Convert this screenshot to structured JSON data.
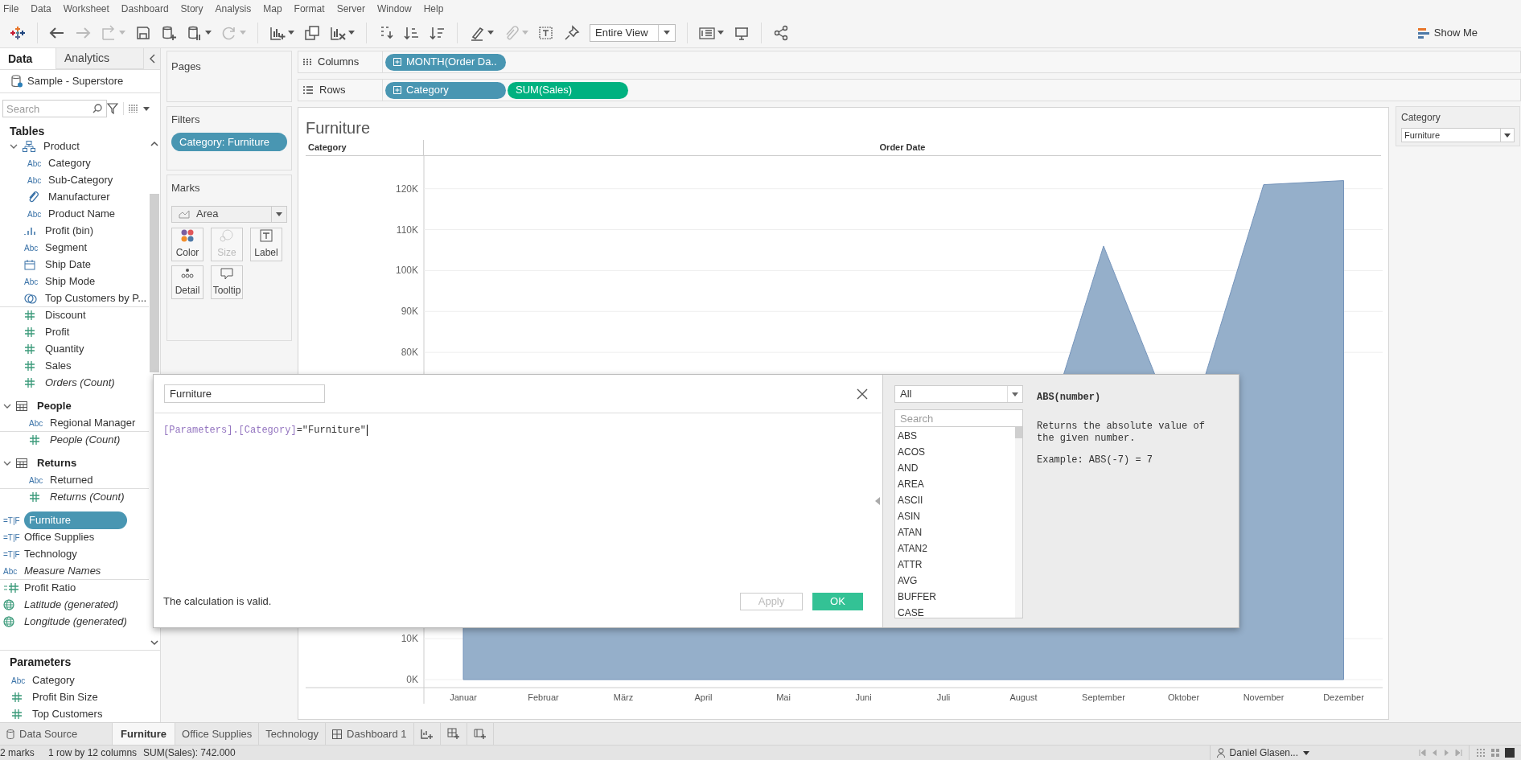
{
  "menu": [
    "File",
    "Data",
    "Worksheet",
    "Dashboard",
    "Story",
    "Analysis",
    "Map",
    "Format",
    "Server",
    "Window",
    "Help"
  ],
  "toolbar": [
    {
      "kind": "logo"
    },
    {
      "kind": "undo",
      "disabled": false,
      "dropdown": false
    },
    {
      "kind": "redo",
      "disabled": true,
      "dropdown": false
    },
    {
      "kind": "replay",
      "disabled": true,
      "dropdown": true
    },
    {
      "kind": "save",
      "disabled": false,
      "dropdown": false
    },
    {
      "kind": "new-datasource",
      "disabled": false,
      "dropdown": false
    },
    {
      "kind": "pause",
      "disabled": false,
      "dropdown": true
    },
    {
      "kind": "refresh",
      "disabled": true,
      "dropdown": true
    },
    {
      "kind": "new-sheet",
      "disabled": false,
      "dropdown": true
    },
    {
      "kind": "duplicate",
      "disabled": false,
      "dropdown": false
    },
    {
      "kind": "clear",
      "disabled": false,
      "dropdown": true
    },
    {
      "kind": "swap",
      "disabled": false,
      "dropdown": false
    },
    {
      "kind": "sort-asc",
      "disabled": false,
      "dropdown": false
    },
    {
      "kind": "sort-desc",
      "disabled": false,
      "dropdown": false
    },
    {
      "kind": "highlight",
      "disabled": false,
      "dropdown": true
    },
    {
      "kind": "clip",
      "disabled": true,
      "dropdown": true
    },
    {
      "kind": "text",
      "disabled": false,
      "dropdown": false
    },
    {
      "kind": "pin",
      "disabled": false,
      "dropdown": false
    },
    {
      "kind": "fit",
      "label": "Entire View",
      "disabled": false,
      "dropdown": true
    },
    {
      "kind": "cards",
      "disabled": false,
      "dropdown": true
    },
    {
      "kind": "present",
      "disabled": false,
      "dropdown": false
    },
    {
      "kind": "share",
      "disabled": false,
      "dropdown": false
    }
  ],
  "show_me": "Show Me",
  "side_tabs": [
    {
      "label": "Data",
      "selected": true
    },
    {
      "label": "Analytics",
      "selected": false
    }
  ],
  "datasource": "Sample - Superstore",
  "search": {
    "placeholder": "Search"
  },
  "tables_heading": "Tables",
  "fields": [
    {
      "kind": "hierarchy",
      "label": "Product",
      "expanded": true,
      "selected": false,
      "children": [
        {
          "kind": "abc",
          "type_label": "Abc",
          "label": "Category",
          "selected": false
        },
        {
          "kind": "abc",
          "type_label": "Abc",
          "label": "Sub-Category",
          "selected": false
        },
        {
          "kind": "group",
          "label": "Manufacturer",
          "selected": false
        },
        {
          "kind": "abc",
          "type_label": "Abc",
          "label": "Product Name",
          "selected": false
        }
      ]
    },
    {
      "kind": "bin",
      "label": "Profit (bin)",
      "selected": false
    },
    {
      "kind": "abc",
      "type_label": "Abc",
      "label": "Segment",
      "selected": false
    },
    {
      "kind": "date",
      "label": "Ship Date",
      "selected": false
    },
    {
      "kind": "abc",
      "type_label": "Abc",
      "label": "Ship Mode",
      "selected": false
    },
    {
      "kind": "set",
      "label": "Top Customers by P...",
      "selected": false
    },
    {
      "kind": "measure",
      "label": "Discount",
      "separator": true,
      "selected": false
    },
    {
      "kind": "measure",
      "label": "Profit",
      "selected": false
    },
    {
      "kind": "measure",
      "label": "Quantity",
      "selected": false
    },
    {
      "kind": "measure",
      "label": "Sales",
      "selected": false
    },
    {
      "kind": "measure",
      "label": "Orders (Count)",
      "italic": true,
      "selected": false
    },
    {
      "kind": "table",
      "label": "People",
      "expanded": true,
      "selected": false,
      "children": [
        {
          "kind": "abc",
          "type_label": "Abc",
          "label": "Regional Manager",
          "selected": false
        },
        {
          "kind": "measure",
          "label": "People (Count)",
          "italic": true,
          "separator": true,
          "selected": false
        }
      ]
    },
    {
      "kind": "table",
      "label": "Returns",
      "expanded": true,
      "selected": false,
      "children": [
        {
          "kind": "abc",
          "type_label": "Abc",
          "label": "Returned",
          "selected": false
        },
        {
          "kind": "measure",
          "label": "Returns (Count)",
          "italic": true,
          "separator": true,
          "selected": false
        }
      ]
    },
    {
      "kind": "boolean",
      "type_label": "=T|F",
      "label": "Furniture",
      "selected": true
    },
    {
      "kind": "boolean",
      "type_label": "=T|F",
      "label": "Office Supplies",
      "selected": false
    },
    {
      "kind": "boolean",
      "type_label": "=T|F",
      "label": "Technology",
      "selected": false
    },
    {
      "kind": "abc",
      "type_label": "Abc",
      "label": "Measure Names",
      "italic": true,
      "selected": false
    },
    {
      "kind": "calc",
      "label": "Profit Ratio",
      "separator": true,
      "selected": false
    },
    {
      "kind": "geo",
      "label": "Latitude (generated)",
      "italic": true,
      "selected": false
    },
    {
      "kind": "geo",
      "label": "Longitude (generated)",
      "italic": true,
      "selected": false
    }
  ],
  "parameters": {
    "heading": "Parameters",
    "items": [
      {
        "kind": "abc",
        "type_label": "Abc",
        "label": "Category",
        "selected": false
      },
      {
        "kind": "measure",
        "label": "Profit Bin Size",
        "selected": false
      },
      {
        "kind": "measure",
        "label": "Top Customers",
        "selected": false
      }
    ]
  },
  "pages": {
    "title": "Pages"
  },
  "filters": {
    "title": "Filters",
    "pills": [
      "Category: Furniture"
    ]
  },
  "marks": {
    "title": "Marks",
    "type": "Area",
    "buttons": [
      {
        "kind": "color",
        "label": "Color",
        "disabled": false
      },
      {
        "kind": "size",
        "label": "Size",
        "disabled": true
      },
      {
        "kind": "label",
        "label": "Label",
        "disabled": false
      },
      {
        "kind": "detail",
        "label": "Detail",
        "disabled": false
      },
      {
        "kind": "tooltip",
        "label": "Tooltip",
        "disabled": false
      }
    ]
  },
  "shelves": [
    {
      "kind": "columns",
      "label": "Columns",
      "pills": [
        {
          "label": "MONTH(Order Da..",
          "kind": "discrete",
          "expandable": true
        }
      ]
    },
    {
      "kind": "rows",
      "label": "Rows",
      "pills": [
        {
          "label": "Category",
          "kind": "discrete",
          "expandable": true
        },
        {
          "label": "SUM(Sales)",
          "kind": "continuous",
          "expandable": false
        }
      ]
    }
  ],
  "worksheet": {
    "title": "Furniture",
    "row_header": "Category",
    "column_header": "Order Date",
    "x_axis_labels": [
      "Januar",
      "Februar",
      "März",
      "April",
      "Mai",
      "Juni",
      "Juli",
      "August",
      "September",
      "Oktober",
      "November",
      "Dezember"
    ],
    "y_axis_labels": [
      "120K",
      "110K",
      "100K",
      "90K",
      "80K",
      "10K",
      "0K"
    ]
  },
  "filter_card": {
    "title": "Category",
    "value": "Furniture"
  },
  "calc_dialog": {
    "name": "Furniture",
    "formula": [
      {
        "kind": "field",
        "text": "[Parameters].[Category]"
      },
      {
        "kind": "operator",
        "text": "="
      },
      {
        "kind": "string",
        "text": "\"Furniture\""
      }
    ],
    "status": "The calculation is valid.",
    "apply": {
      "label": "Apply",
      "disabled": true
    },
    "ok": {
      "label": "OK",
      "disabled": false
    },
    "function_category": "All",
    "function_search": {
      "placeholder": "Search"
    },
    "functions": [
      "ABS",
      "ACOS",
      "AND",
      "AREA",
      "ASCII",
      "ASIN",
      "ATAN",
      "ATAN2",
      "ATTR",
      "AVG",
      "BUFFER",
      "CASE"
    ],
    "help": {
      "signature": "ABS(number)",
      "description": "Returns the absolute value of the given number.",
      "example": "Example: ABS(-7) = 7"
    }
  },
  "sheet_tabs": [
    {
      "kind": "datasource",
      "label": "Data Source",
      "selected": false
    },
    {
      "kind": "sheet",
      "label": "Furniture",
      "selected": true
    },
    {
      "kind": "sheet",
      "label": "Office Supplies",
      "selected": false
    },
    {
      "kind": "sheet",
      "label": "Technology",
      "selected": false
    },
    {
      "kind": "dashboard",
      "label": "Dashboard 1",
      "selected": false
    }
  ],
  "status_bar": {
    "marks": "2 marks",
    "dimensions": "1 row by 12 columns",
    "sum": "SUM(Sales): 742.000",
    "user": "Daniel Glasen..."
  }
}
